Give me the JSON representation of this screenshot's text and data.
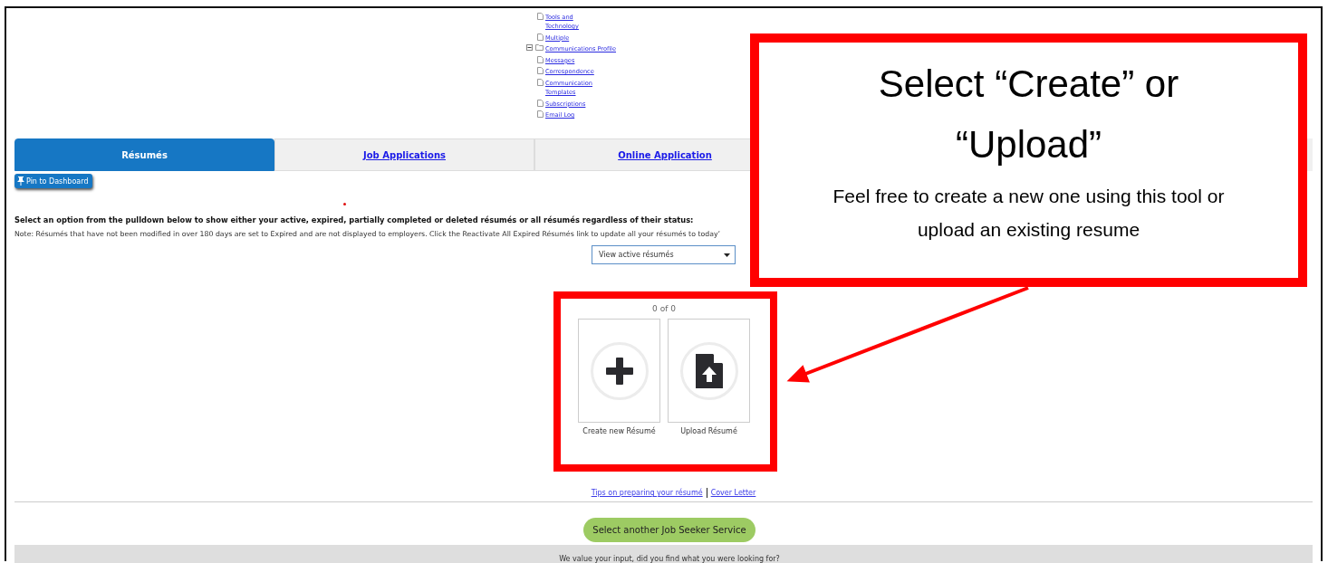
{
  "tree": [
    {
      "label": "Tools and Technology",
      "kind": "leaf"
    },
    {
      "label": "Multiple",
      "kind": "leaf"
    },
    {
      "label": "Communications Profile",
      "kind": "folder",
      "expanded": true,
      "children": [
        {
          "label": "Messages",
          "kind": "leaf"
        },
        {
          "label": "Correspondence",
          "kind": "leaf"
        },
        {
          "label": "Communication Templates",
          "kind": "leaf"
        },
        {
          "label": "Subscriptions",
          "kind": "leaf"
        },
        {
          "label": "Email Log",
          "kind": "leaf"
        }
      ]
    }
  ],
  "tabs": [
    {
      "label": "Résumés",
      "selected": true
    },
    {
      "label": "Job Applications",
      "selected": false
    },
    {
      "label": "Online Application",
      "selected": false
    }
  ],
  "pin_button": "Pin to Dashboard",
  "instructions": "Select an option from the pulldown below to show either your active, expired, partially completed or deleted résumés or all résumés regardless of their status:",
  "note": "Note: Résumés that have not been modified in over 180 days are set to Expired and are not displayed to employers. Click the Reactivate All Expired Résumés link to update all your résumés to today’",
  "filter_select": {
    "value": "View active résumés"
  },
  "counter": "0 of 0",
  "tiles": [
    {
      "label": "Create new Résumé",
      "kind": "create"
    },
    {
      "label": "Upload Résumé",
      "kind": "upload"
    }
  ],
  "links": [
    "Tips on preparing your résumé",
    "Cover Letter"
  ],
  "service_button": "Select another Job Seeker Service",
  "feedback": "We value your input, did you find what you were looking for?",
  "callout": {
    "title": "Select “Create” or “Upload”",
    "body": "Feel free to create a new one using this tool or upload an existing resume"
  }
}
